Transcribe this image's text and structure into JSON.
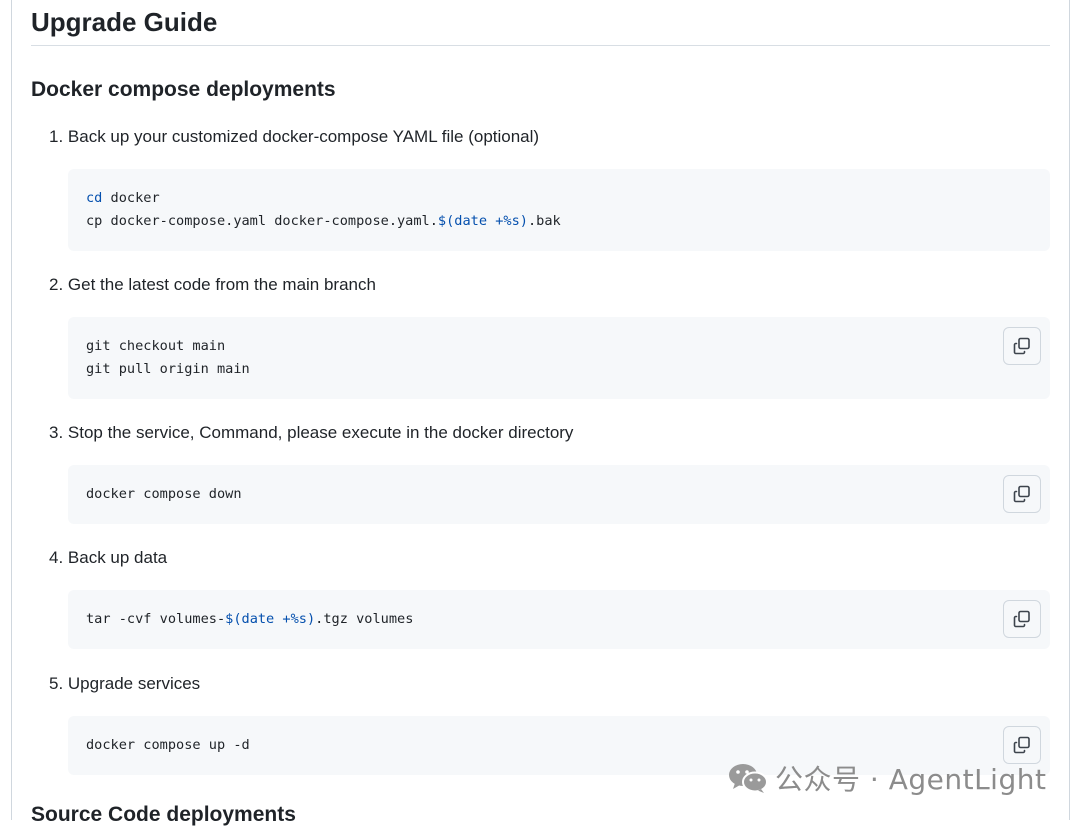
{
  "page_title": "Upgrade Guide",
  "sections": {
    "docker": {
      "heading": "Docker compose deployments"
    },
    "source": {
      "heading": "Source Code deployments"
    }
  },
  "steps": [
    {
      "label": "1. Back up your customized docker-compose YAML file (optional)",
      "code": [
        {
          "kw": "cd",
          "rest": " docker"
        },
        {
          "pre": "cp docker-compose.yaml docker-compose.yaml.",
          "expr": "$(date +%s)",
          "post": ".bak"
        }
      ]
    },
    {
      "label": "2. Get the latest code from the main branch",
      "code": [
        "git checkout main",
        "git pull origin main"
      ]
    },
    {
      "label": "3. Stop the service, Command, please execute in the docker directory",
      "code": [
        "docker compose down"
      ]
    },
    {
      "label": "4. Back up data",
      "code": [
        {
          "pre": "tar -cvf volumes-",
          "expr": "$(date +%s)",
          "post": ".tgz volumes"
        }
      ]
    },
    {
      "label": "5. Upgrade services",
      "code": [
        "docker compose up -d"
      ]
    }
  ],
  "watermark": {
    "text": "公众号 · AgentLight",
    "icon": "wechat-icon"
  },
  "icons": {
    "copy": "copy-icon"
  },
  "colors": {
    "keyword": "#0550ae",
    "code_bg": "#f6f8fa",
    "border": "#d0d7de"
  }
}
